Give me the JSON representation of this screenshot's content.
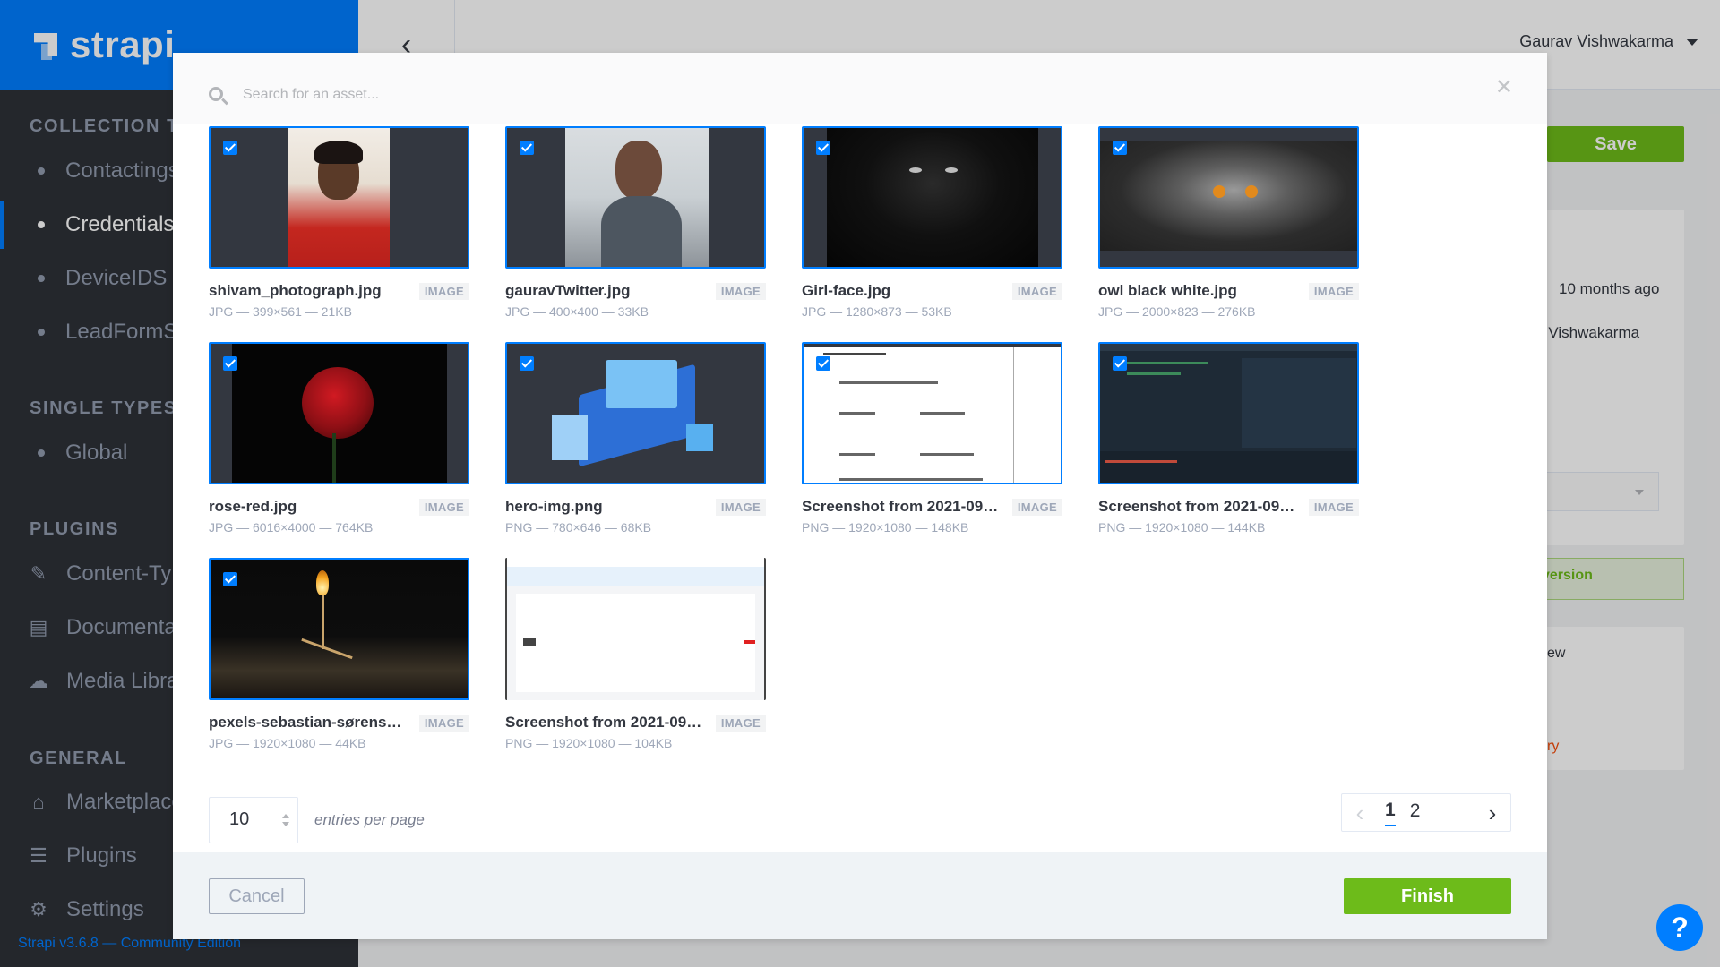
{
  "brand": {
    "name": "strapi"
  },
  "sidebar": {
    "sections": [
      {
        "label": "COLLECTION TYPES"
      },
      {
        "label": "SINGLE TYPES"
      },
      {
        "label": "PLUGINS"
      },
      {
        "label": "GENERAL"
      }
    ],
    "collection_types": [
      {
        "label": "Contactings"
      },
      {
        "label": "Credentials"
      },
      {
        "label": "DeviceIDS"
      },
      {
        "label": "LeadFormSubmissions"
      }
    ],
    "single_types": [
      {
        "label": "Global"
      }
    ],
    "plugins": [
      {
        "label": "Content-Types Builder",
        "icon": "brush-icon"
      },
      {
        "label": "Documentation",
        "icon": "book-icon"
      },
      {
        "label": "Media Library",
        "icon": "cloud-upload-icon"
      }
    ],
    "general": [
      {
        "label": "Marketplace",
        "icon": "basket-icon"
      },
      {
        "label": "Plugins",
        "icon": "list-icon"
      },
      {
        "label": "Settings",
        "icon": "gear-icon"
      }
    ],
    "version": "Strapi v3.6.8 — Community Edition"
  },
  "header": {
    "user_name": "Gaurav Vishwakarma"
  },
  "background_page": {
    "save_label": "Save",
    "last_update": "10 months ago",
    "author": "rav Vishwakarma",
    "version_label": "version",
    "preview_label": "ew",
    "delete_label": "ry"
  },
  "modal": {
    "search_placeholder": "Search for an asset...",
    "assets": [
      {
        "name": "shivam_photograph.jpg",
        "type": "IMAGE",
        "meta": "JPG — 399×561 — 21KB",
        "selected": true
      },
      {
        "name": "gauravTwitter.jpg",
        "type": "IMAGE",
        "meta": "JPG — 400×400 — 33KB",
        "selected": true
      },
      {
        "name": "Girl-face.jpg",
        "type": "IMAGE",
        "meta": "JPG — 1280×873 — 53KB",
        "selected": true
      },
      {
        "name": "owl black white.jpg",
        "type": "IMAGE",
        "meta": "JPG — 2000×823 — 276KB",
        "selected": true
      },
      {
        "name": "rose-red.jpg",
        "type": "IMAGE",
        "meta": "JPG — 6016×4000 — 764KB",
        "selected": true
      },
      {
        "name": "hero-img.png",
        "type": "IMAGE",
        "meta": "PNG — 780×646 — 68KB",
        "selected": true
      },
      {
        "name": "Screenshot from 2021-09-...",
        "type": "IMAGE",
        "meta": "PNG — 1920×1080 — 148KB",
        "selected": true
      },
      {
        "name": "Screenshot from 2021-09-...",
        "type": "IMAGE",
        "meta": "PNG — 1920×1080 — 144KB",
        "selected": true
      },
      {
        "name": "pexels-sebastian-sørensen...",
        "type": "IMAGE",
        "meta": "JPG — 1920×1080 — 44KB",
        "selected": true
      },
      {
        "name": "Screenshot from 2021-09-...",
        "type": "IMAGE",
        "meta": "PNG — 1920×1080 — 104KB",
        "selected": false
      }
    ],
    "entries_per_page": "10",
    "entries_label": "entries per page",
    "pagination": {
      "current": "1",
      "pages": [
        "1",
        "2"
      ]
    },
    "cancel_label": "Cancel",
    "finish_label": "Finish"
  },
  "help": {
    "label": "?"
  },
  "colors": {
    "primary": "#007eff",
    "success": "#6dbb1a",
    "sidebar_bg": "#2e3138"
  }
}
